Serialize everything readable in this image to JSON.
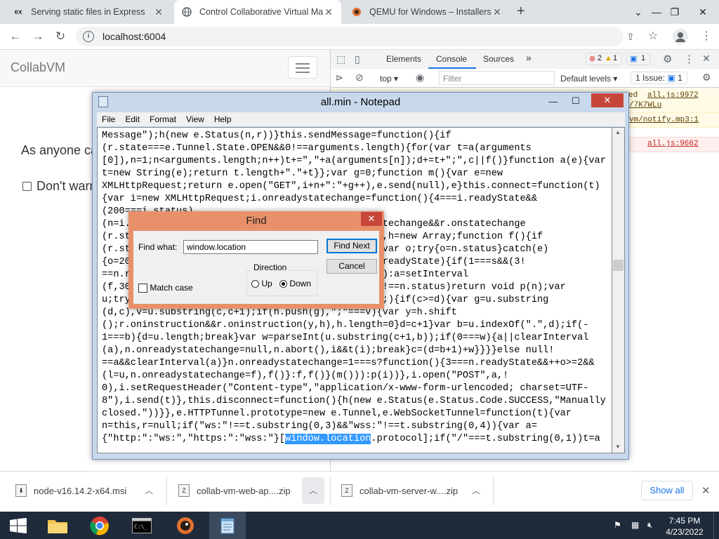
{
  "browser": {
    "tabs": [
      {
        "label": "Serving static files in Express",
        "favicon": "ex"
      },
      {
        "label": "Control Collaborative Virtual Ma",
        "active": true
      },
      {
        "label": "QEMU for Windows – Installers ("
      }
    ],
    "new_tab_symbol": "+",
    "url": "localhost:6004"
  },
  "page": {
    "brand": "CollabVM",
    "heading_partial": "As anyone ca",
    "checkbox_label_partial": "Don't warn"
  },
  "devtools": {
    "tabs": [
      "Elements",
      "Console",
      "Sources"
    ],
    "active_tab": "Console",
    "more": "»",
    "error_count": "2",
    "warning_count": "1",
    "message_count": "1",
    "context": "top",
    "filter_placeholder": "Filter",
    "levels": "Default levels",
    "issues_label": "1 Issue:",
    "issues_count": "1",
    "console_lines": [
      {
        "left": "ed",
        "right": "all.js:9972",
        "sub": "/7K7WLu"
      },
      {
        "left": "",
        "right": "vm/notify.mp3:1",
        "sub": ""
      },
      {
        "left": "",
        "right": "all.js:9662",
        "sub": ""
      }
    ]
  },
  "notepad": {
    "title": "all.min - Notepad",
    "menu": [
      "File",
      "Edit",
      "Format",
      "View",
      "Help"
    ],
    "lines": [
      "Message\");h(new e.Status(n,r))}this.sendMessage=function(){if",
      "(r.state===e.Tunnel.State.OPEN&&0!==arguments.length){for(var t=a(arguments",
      "[0]),n=1;n<arguments.length;n++)t+=\",\"+a(arguments[n]);d+=t+\";\",c||f()}function a(e){var",
      "t=new String(e);return t.length+\".\"+t}};var g=0;function m(){var e=new",
      "XMLHttpRequest;return e.open(\"GET\",i+n+\":\"+g++),e.send(null),e}this.connect=function(t)",
      "{var i=new XMLHttpRequest;i.onreadystatechange=function(){4===i.readyState&&",
      "(200===i.status)",
      "(n=i.                                         statechange&&r.onstatechange",
      "(r.st                                         d=0,h=new Array;function f(){if",
      "(r.st                                         )){var o;try{o=n.status}catch(e)",
      "{o=20                                         =n.readyState){if(1===s&&(3!",
      "==n.r                                         l(a):a=setInterval",
      "(f,30                                         200!==n.status)return void p(n);var",
      "u;try                                         gth;){if(c>=d){var g=u.substring",
      "(d,c),v=u.substring(c,c+1);if(h.push(g),\";\"===v){var y=h.shift",
      "();r.oninstruction&&r.oninstruction(y,h),h.length=0}d=c+1}var b=u.indexOf(\".\",d);if(-",
      "1===b){d=u.length;break}var w=parseInt(u.substring(c+1,b));if(0===w){a||clearInterval",
      "(a),n.onreadystatechange=null,n.abort(),i&&t(i);break}c=(d=b+1)+w}}}}else null!",
      "==a&&clearInterval(a)}n.onreadystatechange=1===s?function(){3===n.readyState&&++o>=2&&",
      "(l=u,n.onreadystatechange=f),f()}:f,f()}(m())):p(i))},i.open(\"POST\",a,!",
      "0),i.setRequestHeader(\"Content-type\",\"application/x-www-form-urlencoded; charset=UTF-",
      "8\"),i.send(t)},this.disconnect=function(){h(new e.Status(e.Status.Code.SUCCESS,\"Manually",
      "closed.\"))}},e.HTTPTunnel.prototype=new e.Tunnel,e.WebSocketTunnel=function(t){var",
      "n=this,r=null;if(\"ws:\"!==t.substring(0,3)&&\"wss:\"!==t.substring(0,4)){var a="
    ],
    "last_line_before": "{\"http:\":\"ws:\",\"https:\":\"wss:\"}[",
    "last_line_highlight": "window.location",
    "last_line_after": ".protocol];if(\"/\"===t.substring(0,1))t=a"
  },
  "find_dialog": {
    "title": "Find",
    "find_what_label": "Find what:",
    "find_what_value": "window.location",
    "find_next": "Find Next",
    "cancel": "Cancel",
    "direction_label": "Direction",
    "up_label": "Up",
    "down_label": "Down",
    "direction_selected": "Down",
    "match_case_label": "Match case",
    "match_case_checked": false
  },
  "downloads": {
    "items": [
      "node-v16.14.2-x64.msi",
      "collab-vm-web-ap....zip",
      "collab-vm-server-w....zip"
    ],
    "show_all": "Show all"
  },
  "taskbar": {
    "time": "7:45 PM",
    "date": "4/23/2022"
  }
}
